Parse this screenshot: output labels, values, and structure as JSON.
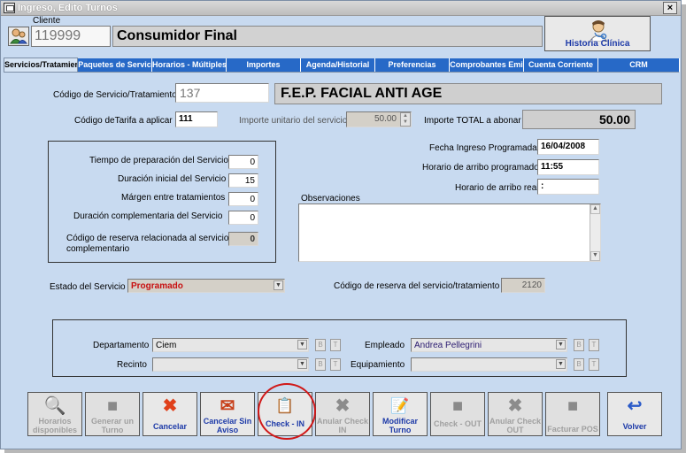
{
  "window": {
    "title": "Ingreso, Edito Turnos",
    "close": "×"
  },
  "cliente": {
    "label": "Cliente",
    "code": "119999",
    "name": "Consumidor Final",
    "historia_button": "Historia Clínica"
  },
  "tabs": [
    {
      "label": "Servicios/Tratamier",
      "active": true
    },
    {
      "label": "Paquetes de Servic",
      "active": false
    },
    {
      "label": "Horarios - Múltiples",
      "active": false
    },
    {
      "label": "Importes",
      "active": false
    },
    {
      "label": "Agenda/Historial",
      "active": false
    },
    {
      "label": "Preferencias",
      "active": false
    },
    {
      "label": "Comprobantes Emi",
      "active": false
    },
    {
      "label": "Cuenta Corriente",
      "active": false
    },
    {
      "label": "CRM",
      "active": false
    }
  ],
  "servicio": {
    "codigo_label": "Código de Servicio/Tratamiento",
    "codigo_value": "137",
    "nombre": "F.E.P.  FACIAL ANTI AGE",
    "tarifa_label": "Código deTarifa a aplicar",
    "tarifa_value": "111",
    "importe_unitario_label": "Importe unitario del servicio",
    "importe_unitario_value": "50.00",
    "importe_total_label": "Importe TOTAL a abonar",
    "importe_total_value": "50.00"
  },
  "tiempos": {
    "preparacion_label": "Tiempo de preparación del Servicio",
    "preparacion_value": "0",
    "duracion_label": "Duración inicial del Servicio",
    "duracion_value": "15",
    "margen_label": "Márgen entre tratamientos",
    "margen_value": "0",
    "duracion_comp_label": "Duración  complementaria  del Servicio",
    "duracion_comp_value": "0",
    "reserva_rel_label_1": "Código de reserva relacionada al  servicio",
    "reserva_rel_label_2": "complementario",
    "reserva_rel_value": "0"
  },
  "fechas": {
    "fecha_label": "Fecha Ingreso Programada",
    "fecha_value": "16/04/2008",
    "horario_prog_label": "Horario de arribo programado",
    "horario_prog_value": "11:55",
    "horario_real_label": "Horario de arribo real",
    "horario_real_value": " :"
  },
  "observaciones": {
    "label": "Observaciones",
    "value": ""
  },
  "estado": {
    "label": "Estado del Servicio",
    "value": "Programado",
    "color": "#c81010",
    "reserva_label": "Código de reserva del servicio/tratamiento",
    "reserva_value": "2120"
  },
  "asignacion": {
    "departamento_label": "Departamento",
    "departamento_value": "Ciem",
    "recinto_label": "Recinto",
    "recinto_value": "",
    "empleado_label": "Empleado",
    "empleado_value": "Andrea Pellegrini",
    "equipamiento_label": "Equipamiento",
    "equipamiento_value": "",
    "b_label": "B",
    "t_label": "T"
  },
  "toolbar": [
    {
      "label": "Horarios disponibles",
      "icon": "magnifier-icon",
      "glyph": "🔍",
      "enabled": false
    },
    {
      "label": "Generar un Turno",
      "icon": "square-icon",
      "glyph": "■",
      "enabled": false
    },
    {
      "label": "Cancelar",
      "icon": "x-icon",
      "glyph": "✖",
      "enabled": true
    },
    {
      "label": "Cancelar Sin Aviso",
      "icon": "x-envelope-icon",
      "glyph": "✉",
      "enabled": true
    },
    {
      "label": "Check - IN",
      "icon": "checkin-icon",
      "glyph": "📋",
      "enabled": true
    },
    {
      "label": "Anular Check IN",
      "icon": "x-icon",
      "glyph": "✖",
      "enabled": false
    },
    {
      "label": "Modificar Turno",
      "icon": "edit-icon",
      "glyph": "📝",
      "enabled": true
    },
    {
      "label": "Check - OUT",
      "icon": "square-icon",
      "glyph": "■",
      "enabled": false
    },
    {
      "label": "Anular Check OUT",
      "icon": "x-icon",
      "glyph": "✖",
      "enabled": false
    },
    {
      "label": "Facturar POS",
      "icon": "square-icon",
      "glyph": "■",
      "enabled": false
    },
    {
      "label": "Volver",
      "icon": "back-arrow-icon",
      "glyph": "↩",
      "enabled": true
    }
  ],
  "colors": {
    "accent": "#2769c7",
    "background": "#c8daf0",
    "highlight": "#d01818",
    "button_text": "#1d3aa8"
  }
}
